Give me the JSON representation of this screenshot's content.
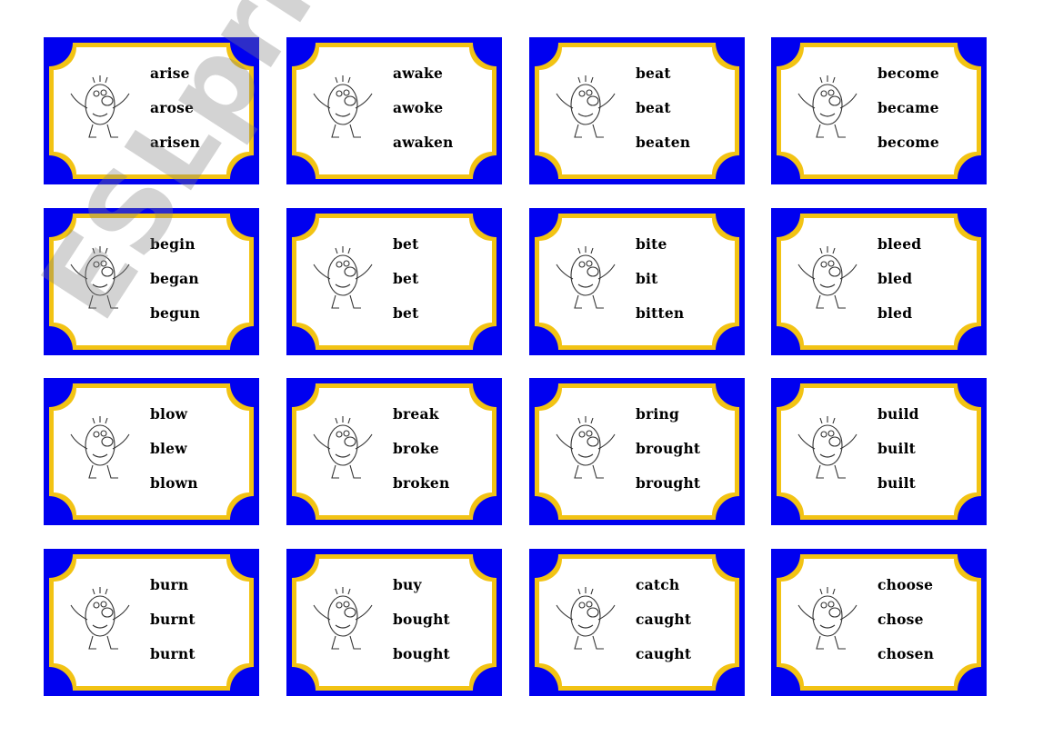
{
  "colors": {
    "card_border": "#0000f0",
    "frame": "#f2c314",
    "card_bg": "#ffffff",
    "text": "#000000"
  },
  "watermark": "ESLprintables.com",
  "cards": [
    {
      "icon": "box-jump-icon",
      "forms": [
        "arise",
        "arose",
        "arisen"
      ]
    },
    {
      "icon": "stretch-bed-icon",
      "forms": [
        "awake",
        "awoke",
        "awaken"
      ]
    },
    {
      "icon": "fight-icon",
      "forms": [
        "beat",
        "beat",
        "beaten"
      ]
    },
    {
      "icon": "statue-icon",
      "forms": [
        "become",
        "became",
        "become"
      ]
    },
    {
      "icon": "painter-icon",
      "forms": [
        "begin",
        "began",
        "begun"
      ]
    },
    {
      "icon": "chips-bet-icon",
      "forms": [
        "bet",
        "bet",
        "bet"
      ]
    },
    {
      "icon": "dog-bite-icon",
      "forms": [
        "bite",
        "bit",
        "bitten"
      ]
    },
    {
      "icon": "knife-cut-icon",
      "forms": [
        "bleed",
        "bled",
        "bled"
      ]
    },
    {
      "icon": "candle-blow-icon",
      "forms": [
        "blow",
        "blew",
        "blown"
      ]
    },
    {
      "icon": "break-stick-icon",
      "forms": [
        "break",
        "broke",
        "broken"
      ]
    },
    {
      "icon": "dog-bring-icon",
      "forms": [
        "bring",
        "brought",
        "brought"
      ]
    },
    {
      "icon": "brick-wall-icon",
      "forms": [
        "build",
        "built",
        "built"
      ]
    },
    {
      "icon": "fire-burn-icon",
      "forms": [
        "burn",
        "burnt",
        "burnt"
      ]
    },
    {
      "icon": "shopping-bags-icon",
      "forms": [
        "buy",
        "bought",
        "bought"
      ]
    },
    {
      "icon": "catch-ball-icon",
      "forms": [
        "catch",
        "caught",
        "caught"
      ]
    },
    {
      "icon": "bottles-choose-icon",
      "forms": [
        "choose",
        "chose",
        "chosen"
      ]
    }
  ]
}
